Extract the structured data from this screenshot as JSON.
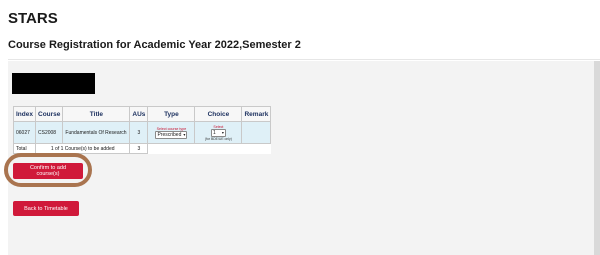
{
  "app": {
    "title": "STARS"
  },
  "page": {
    "subtitle": "Course Registration for Academic Year 2022,Semester 2"
  },
  "table": {
    "headers": {
      "index": "Index",
      "course": "Course",
      "title": "Title",
      "aus": "AUs",
      "type": "Type",
      "choice": "Choice",
      "remark": "Remark"
    },
    "rows": [
      {
        "index": "06027",
        "course": "CS2008",
        "title": "Fundamentals Of Research",
        "aus": "3",
        "type_hint": "Select course type",
        "type_value": "Prescribed",
        "choice_hint": "Select",
        "choice_value": "1",
        "choice_note": "(for BDE/UE only)",
        "remark": ""
      }
    ],
    "total": {
      "label": "Total",
      "summary": "1 of 1 Course(s) to be added",
      "aus": "3"
    }
  },
  "actions": {
    "confirm_label": "Confirm to add course(s)",
    "back_label": "Back to Timetable"
  },
  "colors": {
    "button_bg": "#d0193a",
    "highlight_ring": "#a9744f",
    "row_bg": "#dff0f7",
    "header_text": "#1e3260"
  }
}
